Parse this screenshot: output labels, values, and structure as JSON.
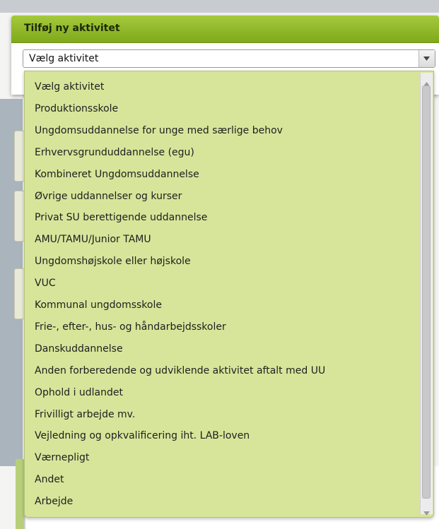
{
  "dialog": {
    "title": "Tilføj ny aktivitet",
    "select": {
      "value": "Vælg aktivitet"
    }
  },
  "dropdown": {
    "options": [
      "Vælg aktivitet",
      "Produktionsskole",
      "Ungdomsuddannelse for unge med særlige behov",
      "Erhvervsgrunduddannelse (egu)",
      "Kombineret Ungdomsuddannelse",
      "Øvrige uddannelser og kurser",
      "Privat SU berettigende uddannelse",
      "AMU/TAMU/Junior TAMU",
      "Ungdomshøjskole eller højskole",
      "VUC",
      "Kommunal ungdomsskole",
      "Frie-, efter-, hus- og håndarbejdsskoler",
      "Danskuddannelse",
      "Anden forberedende og udviklende aktivitet aftalt med UU",
      "Ophold i udlandet",
      "Frivilligt arbejde mv.",
      "Vejledning og opkvalificering iht. LAB-loven",
      "Værnepligt",
      "Andet",
      "Arbejde"
    ]
  },
  "colors": {
    "header_green": "#8db52a",
    "list_background": "#d7e59a"
  },
  "icons": {
    "select_arrow": "chevron-down-icon",
    "scroll_up": "scroll-up-arrow-icon",
    "scroll_down": "scroll-down-arrow-icon"
  }
}
